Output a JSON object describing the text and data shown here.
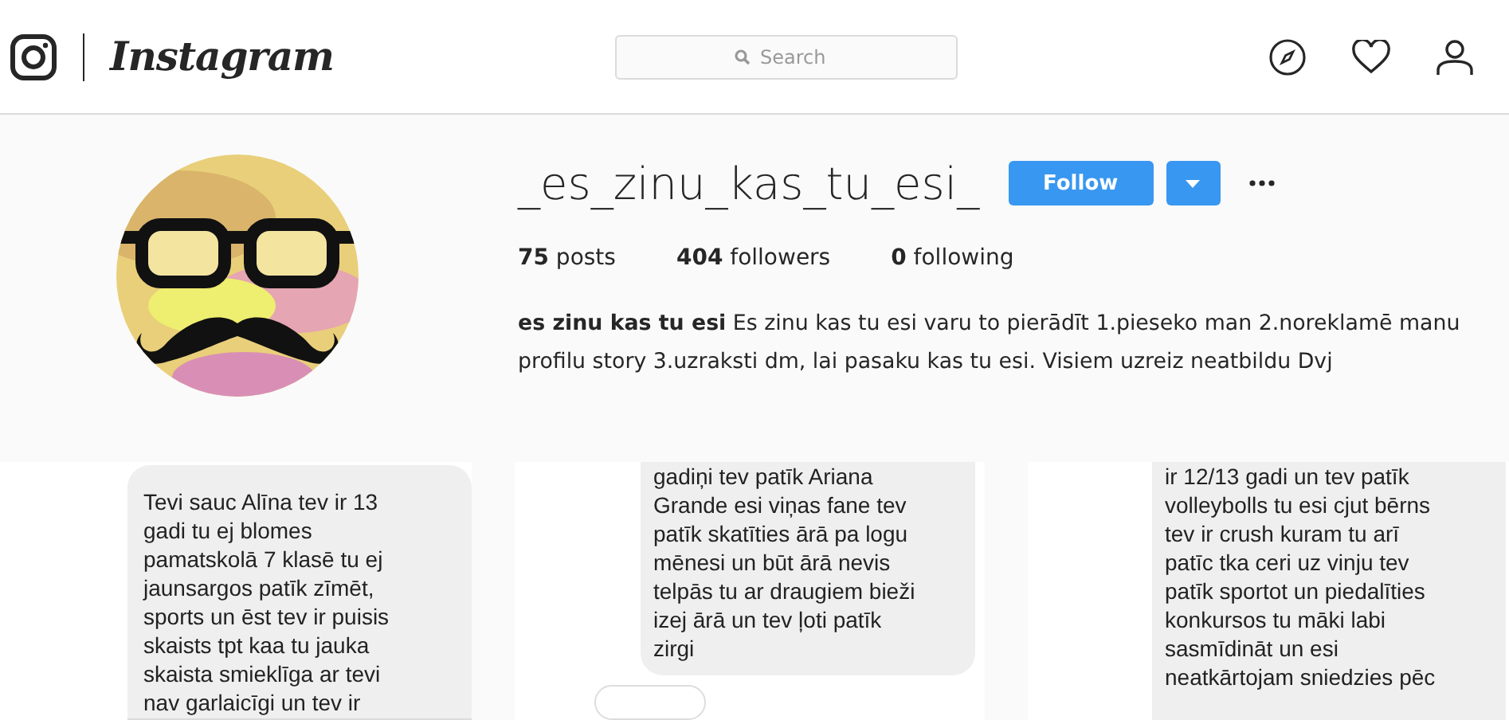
{
  "header": {
    "logo_text": "Instagram",
    "search": {
      "placeholder": "Search"
    }
  },
  "profile": {
    "username": "_es_zinu_kas_tu_esi_",
    "follow_button": "Follow",
    "stats": [
      {
        "value": "75",
        "label": "posts"
      },
      {
        "value": "404",
        "label": "followers"
      },
      {
        "value": "0",
        "label": "following"
      }
    ],
    "bio": "**es zinu kas tu esi** Es zinu kas tu esi varu to pierādīt 1.pieseko man 2.noreklamē manu profilu story 3.uzraksti dm, lai pasaku kas tu esi. Visiem uzreiz neatbildu Dvj"
  },
  "posts": [
    {
      "kind": "bubble_top",
      "lines": [
        "Tevi sauc Alīna tev ir 13",
        "gadi tu ej blomes",
        "pamatskolā 7 klasē tu ej",
        "jaunsargos patīk zīmēt,",
        "sports un ēst tev ir puisis",
        "skaists tpt kaa tu jauka",
        "skaista smieklīga ar tevi",
        "nav garlaicīgi un tev ir"
      ]
    },
    {
      "kind": "bubble_bottom",
      "lines": [
        "gadiņi tev patīk Ariana",
        "Grande esi viņas fane tev",
        "patīk skatīties ārā pa logu",
        "mēnesi un būt ārā nevis",
        "telpās tu ar draugiem bieži",
        "izej ārā un tev ļoti patīk",
        "zirgi"
      ]
    },
    {
      "kind": "bubble_middle",
      "lines": [
        "ir 12/13 gadi un tev patīk",
        "volleybolls tu esi cjut bērns",
        "tev ir crush kuram tu arī",
        "patīc tka ceri uz vinju tev",
        "patīk sportot un piedalīties",
        "konkursos tu māki labi",
        "sasmīdināt un esi",
        "neatkārtojam sniedzies pēc"
      ]
    }
  ]
}
